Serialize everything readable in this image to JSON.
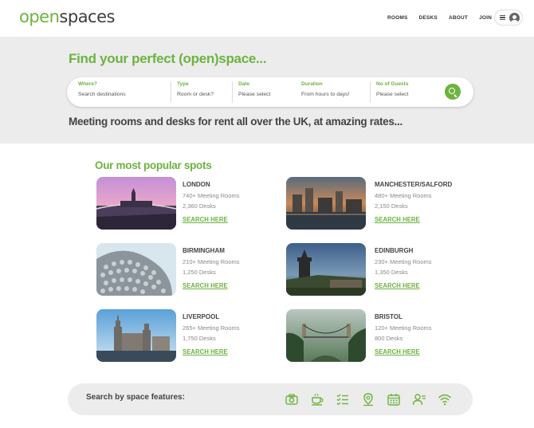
{
  "header": {
    "logo_open": "open",
    "logo_spaces": "spaces",
    "nav": [
      "ROOMS",
      "DESKS",
      "ABOUT",
      "JOIN"
    ]
  },
  "hero": {
    "title": "Find your perfect (open)space...",
    "subtitle": "Meeting rooms and desks for rent all over the UK, at amazing rates...",
    "search": {
      "where_label": "Where?",
      "where_placeholder": "Search destinations",
      "type_label": "Type",
      "type_value": "Room or desk?",
      "date_label": "Date",
      "date_value": "Please select",
      "duration_label": "Duration",
      "duration_value": "From hours to days!",
      "guests_label": "No of Guests",
      "guests_value": "Please select"
    }
  },
  "popular": {
    "title": "Our most popular spots",
    "link_label": "SEARCH HERE",
    "spots": [
      {
        "city": "LONDON",
        "rooms": "740+ Meeting Rooms",
        "desks": "2,360 Desks"
      },
      {
        "city": "MANCHESTER/SALFORD",
        "rooms": "480+ Meeting Rooms",
        "desks": "2,150 Desks"
      },
      {
        "city": "BIRMINGHAM",
        "rooms": "210+ Meeting Rooms",
        "desks": "1,250 Desks"
      },
      {
        "city": "EDINBURGH",
        "rooms": "230+ Meeting Rooms",
        "desks": "1,350 Desks"
      },
      {
        "city": "LIVERPOOL",
        "rooms": "265+ Meeting Rooms",
        "desks": "1,750 Desks"
      },
      {
        "city": "BRISTOL",
        "rooms": "120+ Meeting Rooms",
        "desks": "800 Desks"
      }
    ]
  },
  "features": {
    "label": "Search by space features:",
    "icons": [
      "camera-icon",
      "coffee-icon",
      "checklist-icon",
      "location-pin-icon",
      "calendar-icon",
      "user-list-icon",
      "wifi-icon"
    ]
  },
  "colors": {
    "brand_green": "#6cb33f",
    "hero_bg": "#ececec",
    "text_dark": "#444444"
  }
}
